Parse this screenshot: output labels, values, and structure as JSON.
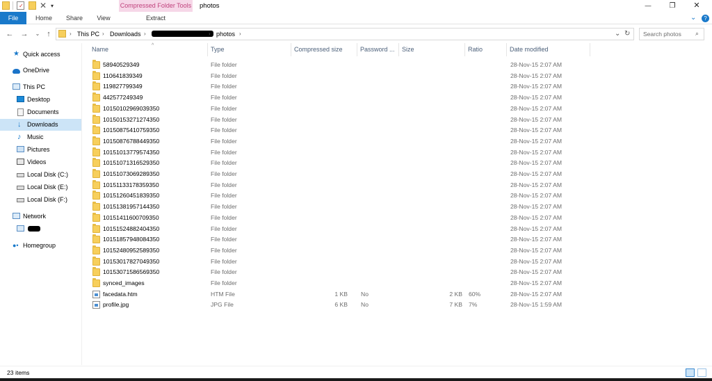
{
  "window": {
    "title": "photos",
    "context_tab": "Compressed Folder Tools",
    "context_subtab": "Extract",
    "qat_dropdown": "▾",
    "controls": {
      "minimize": "—",
      "maximize": "❐",
      "close": "✕"
    }
  },
  "ribbon": {
    "tabs": [
      "File",
      "Home",
      "Share",
      "View"
    ],
    "collapse_caret": "⌄",
    "help": "?"
  },
  "address": {
    "breadcrumb": [
      "This PC",
      "Downloads",
      "photos"
    ],
    "dropdown": "⌄",
    "refresh": "↻",
    "search_placeholder": "Search photos"
  },
  "nav": {
    "items": [
      {
        "label": "Quick access",
        "icon": "star-icon"
      },
      {
        "label": "OneDrive",
        "icon": "cloud-icon"
      },
      {
        "label": "This PC",
        "icon": "computer-icon"
      },
      {
        "label": "Desktop",
        "icon": "desktop-icon"
      },
      {
        "label": "Documents",
        "icon": "documents-icon"
      },
      {
        "label": "Downloads",
        "icon": "downloads-icon",
        "selected": true
      },
      {
        "label": "Music",
        "icon": "music-icon"
      },
      {
        "label": "Pictures",
        "icon": "pictures-icon"
      },
      {
        "label": "Videos",
        "icon": "videos-icon"
      },
      {
        "label": "Local Disk (C:)",
        "icon": "drive-icon"
      },
      {
        "label": "Local Disk (E:)",
        "icon": "drive-icon"
      },
      {
        "label": "Local Disk (F:)",
        "icon": "drive-icon"
      },
      {
        "label": "Network",
        "icon": "network-icon"
      },
      {
        "label": "",
        "icon": "computer-icon"
      },
      {
        "label": "Homegroup",
        "icon": "homegroup-icon"
      }
    ]
  },
  "columns": [
    "Name",
    "Type",
    "Compressed size",
    "Password ...",
    "Size",
    "Ratio",
    "Date modified"
  ],
  "files": [
    {
      "name": "58940529349",
      "type": "File folder",
      "compressed": "",
      "password": "",
      "size": "",
      "ratio": "",
      "date": "28-Nov-15 2:07 AM",
      "kind": "folder"
    },
    {
      "name": "110641839349",
      "type": "File folder",
      "compressed": "",
      "password": "",
      "size": "",
      "ratio": "",
      "date": "28-Nov-15 2:07 AM",
      "kind": "folder"
    },
    {
      "name": "119827799349",
      "type": "File folder",
      "compressed": "",
      "password": "",
      "size": "",
      "ratio": "",
      "date": "28-Nov-15 2:07 AM",
      "kind": "folder"
    },
    {
      "name": "442577249349",
      "type": "File folder",
      "compressed": "",
      "password": "",
      "size": "",
      "ratio": "",
      "date": "28-Nov-15 2:07 AM",
      "kind": "folder"
    },
    {
      "name": "10150102969039350",
      "type": "File folder",
      "compressed": "",
      "password": "",
      "size": "",
      "ratio": "",
      "date": "28-Nov-15 2:07 AM",
      "kind": "folder"
    },
    {
      "name": "10150153271274350",
      "type": "File folder",
      "compressed": "",
      "password": "",
      "size": "",
      "ratio": "",
      "date": "28-Nov-15 2:07 AM",
      "kind": "folder"
    },
    {
      "name": "10150875410759350",
      "type": "File folder",
      "compressed": "",
      "password": "",
      "size": "",
      "ratio": "",
      "date": "28-Nov-15 2:07 AM",
      "kind": "folder"
    },
    {
      "name": "10150876788449350",
      "type": "File folder",
      "compressed": "",
      "password": "",
      "size": "",
      "ratio": "",
      "date": "28-Nov-15 2:07 AM",
      "kind": "folder"
    },
    {
      "name": "10151013779574350",
      "type": "File folder",
      "compressed": "",
      "password": "",
      "size": "",
      "ratio": "",
      "date": "28-Nov-15 2:07 AM",
      "kind": "folder"
    },
    {
      "name": "10151071316529350",
      "type": "File folder",
      "compressed": "",
      "password": "",
      "size": "",
      "ratio": "",
      "date": "28-Nov-15 2:07 AM",
      "kind": "folder"
    },
    {
      "name": "10151073069289350",
      "type": "File folder",
      "compressed": "",
      "password": "",
      "size": "",
      "ratio": "",
      "date": "28-Nov-15 2:07 AM",
      "kind": "folder"
    },
    {
      "name": "10151133178359350",
      "type": "File folder",
      "compressed": "",
      "password": "",
      "size": "",
      "ratio": "",
      "date": "28-Nov-15 2:07 AM",
      "kind": "folder"
    },
    {
      "name": "10151260451839350",
      "type": "File folder",
      "compressed": "",
      "password": "",
      "size": "",
      "ratio": "",
      "date": "28-Nov-15 2:07 AM",
      "kind": "folder"
    },
    {
      "name": "10151381957144350",
      "type": "File folder",
      "compressed": "",
      "password": "",
      "size": "",
      "ratio": "",
      "date": "28-Nov-15 2:07 AM",
      "kind": "folder"
    },
    {
      "name": "10151411600709350",
      "type": "File folder",
      "compressed": "",
      "password": "",
      "size": "",
      "ratio": "",
      "date": "28-Nov-15 2:07 AM",
      "kind": "folder"
    },
    {
      "name": "10151524882404350",
      "type": "File folder",
      "compressed": "",
      "password": "",
      "size": "",
      "ratio": "",
      "date": "28-Nov-15 2:07 AM",
      "kind": "folder"
    },
    {
      "name": "10151857948084350",
      "type": "File folder",
      "compressed": "",
      "password": "",
      "size": "",
      "ratio": "",
      "date": "28-Nov-15 2:07 AM",
      "kind": "folder"
    },
    {
      "name": "10152480952589350",
      "type": "File folder",
      "compressed": "",
      "password": "",
      "size": "",
      "ratio": "",
      "date": "28-Nov-15 2:07 AM",
      "kind": "folder"
    },
    {
      "name": "10153017827049350",
      "type": "File folder",
      "compressed": "",
      "password": "",
      "size": "",
      "ratio": "",
      "date": "28-Nov-15 2:07 AM",
      "kind": "folder"
    },
    {
      "name": "10153071586569350",
      "type": "File folder",
      "compressed": "",
      "password": "",
      "size": "",
      "ratio": "",
      "date": "28-Nov-15 2:07 AM",
      "kind": "folder"
    },
    {
      "name": "synced_images",
      "type": "File folder",
      "compressed": "",
      "password": "",
      "size": "",
      "ratio": "",
      "date": "28-Nov-15 2:07 AM",
      "kind": "folder"
    },
    {
      "name": "facedata.htm",
      "type": "HTM File",
      "compressed": "1 KB",
      "password": "No",
      "size": "2 KB",
      "ratio": "60%",
      "date": "28-Nov-15 2:07 AM",
      "kind": "file"
    },
    {
      "name": "profile.jpg",
      "type": "JPG File",
      "compressed": "6 KB",
      "password": "No",
      "size": "7 KB",
      "ratio": "7%",
      "date": "28-Nov-15 1:59 AM",
      "kind": "file"
    }
  ],
  "status": {
    "count": "23 items"
  },
  "colors": {
    "accent": "#1979ca",
    "context_tab_bg": "#f6d7e8",
    "context_tab_text": "#c0417c",
    "selection": "#cce4f7",
    "folder": "#f7cf5c"
  }
}
